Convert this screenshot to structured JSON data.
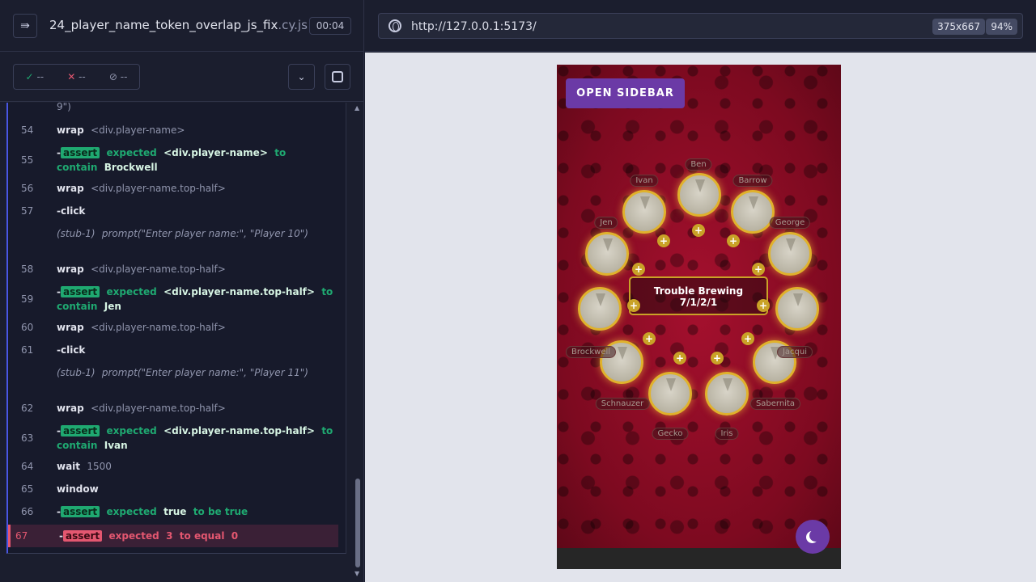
{
  "reporter": {
    "spec_name": "24_player_name_token_overlap_js_fix",
    "spec_ext": ".cy.js",
    "duration": "00:04",
    "stats": {
      "passed": "--",
      "failed": "--",
      "pending": "--"
    },
    "commands": [
      {
        "num": "",
        "type": "cont",
        "text": "9\")"
      },
      {
        "num": "54",
        "type": "cmd",
        "kw": "wrap",
        "arg": "<div.player-name>"
      },
      {
        "num": "55",
        "type": "assert",
        "pre": "expected",
        "subj": "<div.player-name>",
        "mid": "to contain",
        "val": "Brockwell"
      },
      {
        "num": "56",
        "type": "cmd",
        "kw": "wrap",
        "arg": "<div.player-name.top-half>"
      },
      {
        "num": "57",
        "type": "cmd",
        "kw": "-click",
        "arg": ""
      },
      {
        "num": "",
        "type": "stub",
        "label": "(stub-1)",
        "text": "prompt(\"Enter player name:\", \"Player 10\")"
      },
      {
        "num": "58",
        "type": "cmd",
        "kw": "wrap",
        "arg": "<div.player-name.top-half>"
      },
      {
        "num": "59",
        "type": "assert",
        "pre": "expected",
        "subj": "<div.player-name.top-half>",
        "mid": "to contain",
        "val": "Jen"
      },
      {
        "num": "60",
        "type": "cmd",
        "kw": "wrap",
        "arg": "<div.player-name.top-half>"
      },
      {
        "num": "61",
        "type": "cmd",
        "kw": "-click",
        "arg": ""
      },
      {
        "num": "",
        "type": "stub",
        "label": "(stub-1)",
        "text": "prompt(\"Enter player name:\", \"Player 11\")"
      },
      {
        "num": "62",
        "type": "cmd",
        "kw": "wrap",
        "arg": "<div.player-name.top-half>"
      },
      {
        "num": "63",
        "type": "assert",
        "pre": "expected",
        "subj": "<div.player-name.top-half>",
        "mid": "to contain",
        "val": "Ivan"
      },
      {
        "num": "64",
        "type": "cmd",
        "kw": "wait",
        "arg": "1500"
      },
      {
        "num": "65",
        "type": "cmd",
        "kw": "window",
        "arg": ""
      },
      {
        "num": "66",
        "type": "assert",
        "pre": "expected",
        "subj": "true",
        "mid": "to be true",
        "val": ""
      },
      {
        "num": "67",
        "type": "fail",
        "pre": "expected",
        "subj": "3",
        "mid": "to equal",
        "val": "0"
      }
    ],
    "assert_label": "assert"
  },
  "browser": {
    "url": "http://127.0.0.1:5173/",
    "viewport": "375x667",
    "zoom": "94%"
  },
  "app": {
    "sidebar_button": "OPEN SIDEBAR",
    "script_name": "Trouble Brewing",
    "counts": "7/1/2/1",
    "plus": "+",
    "players": [
      "Ben",
      "Ivan",
      "Barrow",
      "Jen",
      "George",
      "Brockwell",
      "Jacqui",
      "Schnauzer",
      "Sabernita",
      "Gecko",
      "Iris"
    ]
  },
  "colors": {
    "accent": "#6b3aa6",
    "pass": "#1fa971",
    "fail": "#e45770",
    "gold": "#e0b22c"
  }
}
